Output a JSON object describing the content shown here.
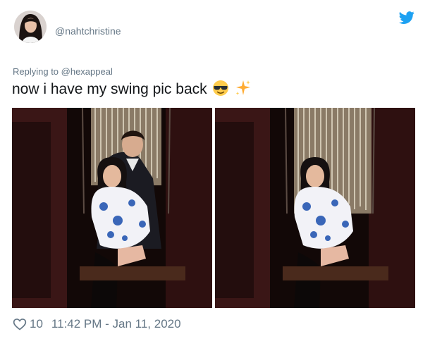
{
  "user": {
    "handle": "@nahtchristine",
    "avatar_icon": "avatar-photo"
  },
  "brand": {
    "logo_icon": "twitter-bird-icon",
    "color": "#1da1f2"
  },
  "tweet": {
    "replying_to": "Replying to @hexappeal",
    "text": "now i have my swing pic back",
    "emojis": [
      "smiling-face-with-sunglasses-emoji",
      "sparkles-emoji"
    ],
    "likes": "10",
    "timestamp": "11:42 PM - Jan 11, 2020"
  },
  "media": [
    {
      "alt": "photo of a woman on a swing with a man behind her"
    },
    {
      "alt": "photo of a woman on a swing, man removed"
    }
  ]
}
